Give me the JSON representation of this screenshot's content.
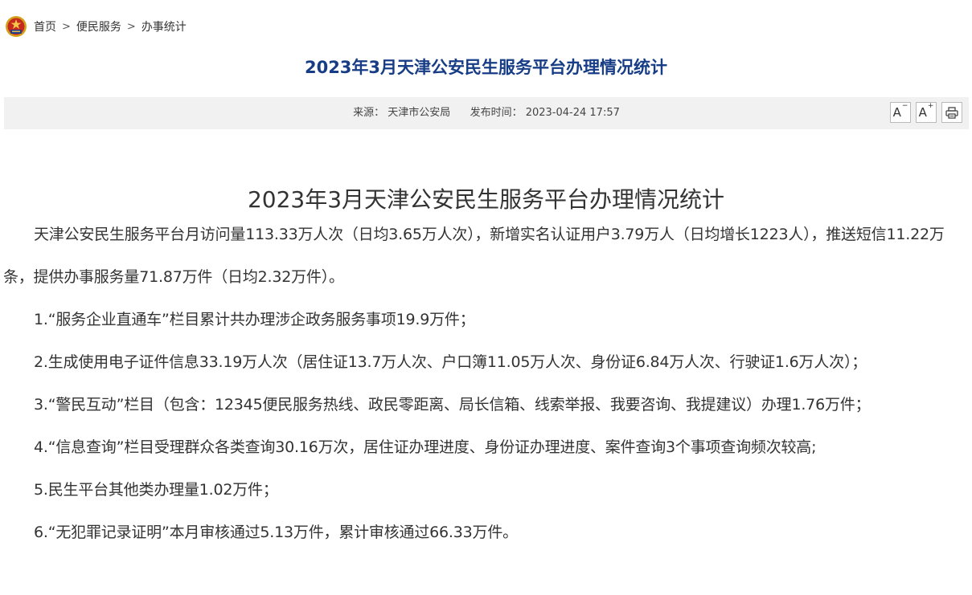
{
  "breadcrumb": {
    "home": "首页",
    "level2": "便民服务",
    "level3": "办事统计",
    "separator": ">"
  },
  "page_title": "2023年3月天津公安民生服务平台办理情况统计",
  "meta": {
    "source_label": "来源：",
    "source": "天津市公安局",
    "time_label": "发布时间：",
    "time": "2023-04-24 17:57"
  },
  "tools": {
    "font_decrease_label": "A",
    "font_decrease_mark": "−",
    "font_increase_label": "A",
    "font_increase_mark": "+"
  },
  "article": {
    "title": "2023年3月天津公安民生服务平台办理情况统计",
    "paragraphs": [
      "天津公安民生服务平台月访问量113.33万人次（日均3.65万人次），新增实名认证用户3.79万人（日均增长1223人），推送短信11.22万条，提供办事服务量71.87万件（日均2.32万件）。",
      "1.“服务企业直通车”栏目累计共办理涉企政务服务事项19.9万件；",
      "2.生成使用电子证件信息33.19万人次（居住证13.7万人次、户口簿11.05万人次、身份证6.84万人次、行驶证1.6万人次）；",
      "3.“警民互动”栏目（包含：12345便民服务热线、政民零距离、局长信箱、线索举报、我要咨询、我提建议）办理1.76万件；",
      "4.“信息查询”栏目受理群众各类查询30.16万次，居住证办理进度、身份证办理进度、案件查询3个事项查询频次较高;",
      "5.民生平台其他类办理量1.02万件；",
      "6.“无犯罪记录证明”本月审核通过5.13万件，累计审核通过66.33万件。"
    ]
  },
  "colors": {
    "title_blue": "#173d86",
    "meta_bg": "#f1f1f1",
    "body_text": "#333333"
  }
}
